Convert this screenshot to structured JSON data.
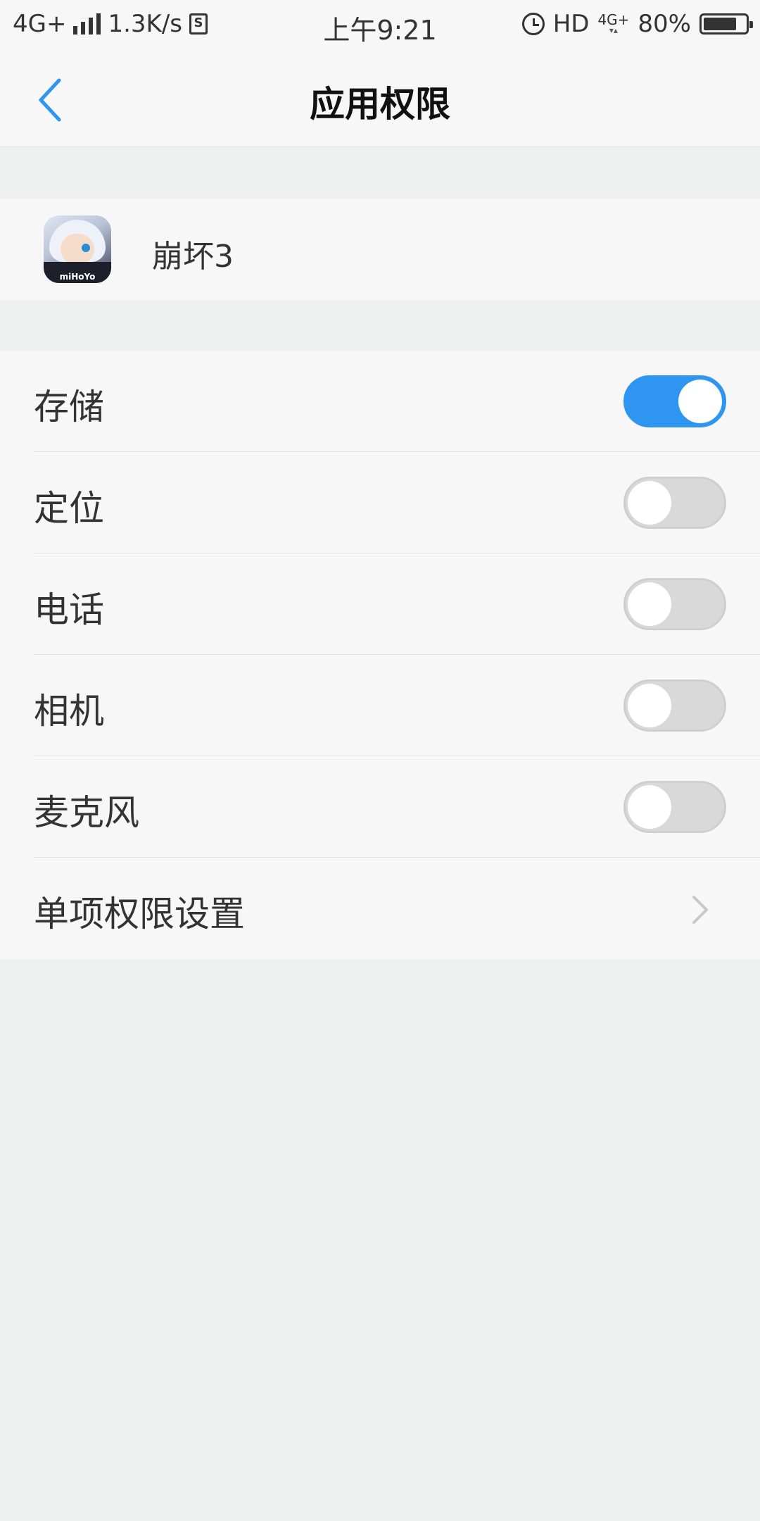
{
  "status_bar": {
    "network": "4G+",
    "speed": "1.3K/s",
    "sim_glyph": "S",
    "time": "上午9:21",
    "hd": "HD",
    "net_4g": "4G+",
    "battery_text": "80%",
    "battery_level": 0.8
  },
  "header": {
    "title": "应用权限",
    "back_icon": "chevron-left-icon"
  },
  "app": {
    "name": "崩坏3",
    "icon_text": "miHoYo"
  },
  "permissions": [
    {
      "label": "存储",
      "enabled": true
    },
    {
      "label": "定位",
      "enabled": false
    },
    {
      "label": "电话",
      "enabled": false
    },
    {
      "label": "相机",
      "enabled": false
    },
    {
      "label": "麦克风",
      "enabled": false
    }
  ],
  "individual_settings": {
    "label": "单项权限设置"
  },
  "colors": {
    "accent": "#2e95f0",
    "toggle_off": "#d9d9d9",
    "background": "#eff1f1",
    "card": "#f7f7f7"
  }
}
